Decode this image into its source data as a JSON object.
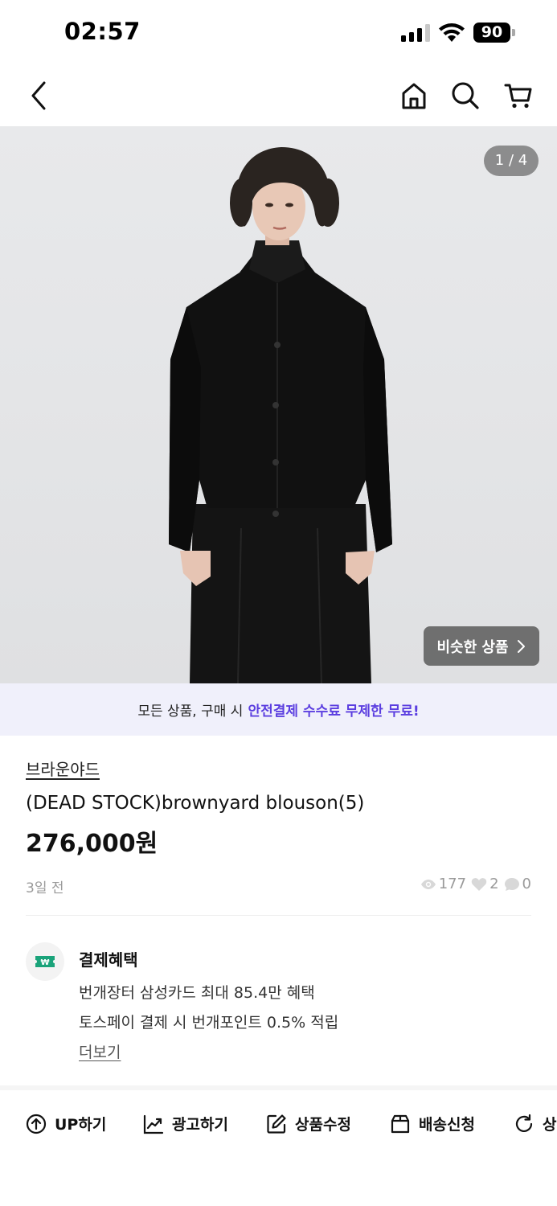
{
  "status_bar": {
    "time": "02:57",
    "battery": "90"
  },
  "nav": {
    "back_icon": "chevron-left-icon",
    "home_icon": "home-icon",
    "search_icon": "search-icon",
    "cart_icon": "cart-icon"
  },
  "product_image": {
    "counter": "1 / 4",
    "similar_button": "비슷한 상품",
    "similar_icon": "chevron-right-icon"
  },
  "promo": {
    "text": "모든 상품, 구매 시",
    "highlight": "안전결제 수수료 무제한 무료!",
    "highlight_color": "#5b3ee0"
  },
  "product": {
    "store": "브라운야드",
    "title": "(DEAD STOCK)brownyard blouson(5)",
    "price": "276,000원",
    "posted": "3일 전",
    "views": "177",
    "likes": "2",
    "chats": "0"
  },
  "benefits": {
    "title": "결제혜택",
    "icon_label": "₩",
    "icon_color": "#1aa37a",
    "lines": [
      "번개장터 삼성카드 최대 85.4만 혜택",
      "토스페이 결제 시 번개포인트 0.5% 적립"
    ],
    "more": "더보기"
  },
  "actions": [
    {
      "label": "UP하기",
      "icon": "arrow-up-circle-icon"
    },
    {
      "label": "광고하기",
      "icon": "trend-chart-icon"
    },
    {
      "label": "상품수정",
      "icon": "edit-icon"
    },
    {
      "label": "배송신청",
      "icon": "box-icon"
    },
    {
      "label": "상",
      "icon": "refresh-icon"
    }
  ]
}
